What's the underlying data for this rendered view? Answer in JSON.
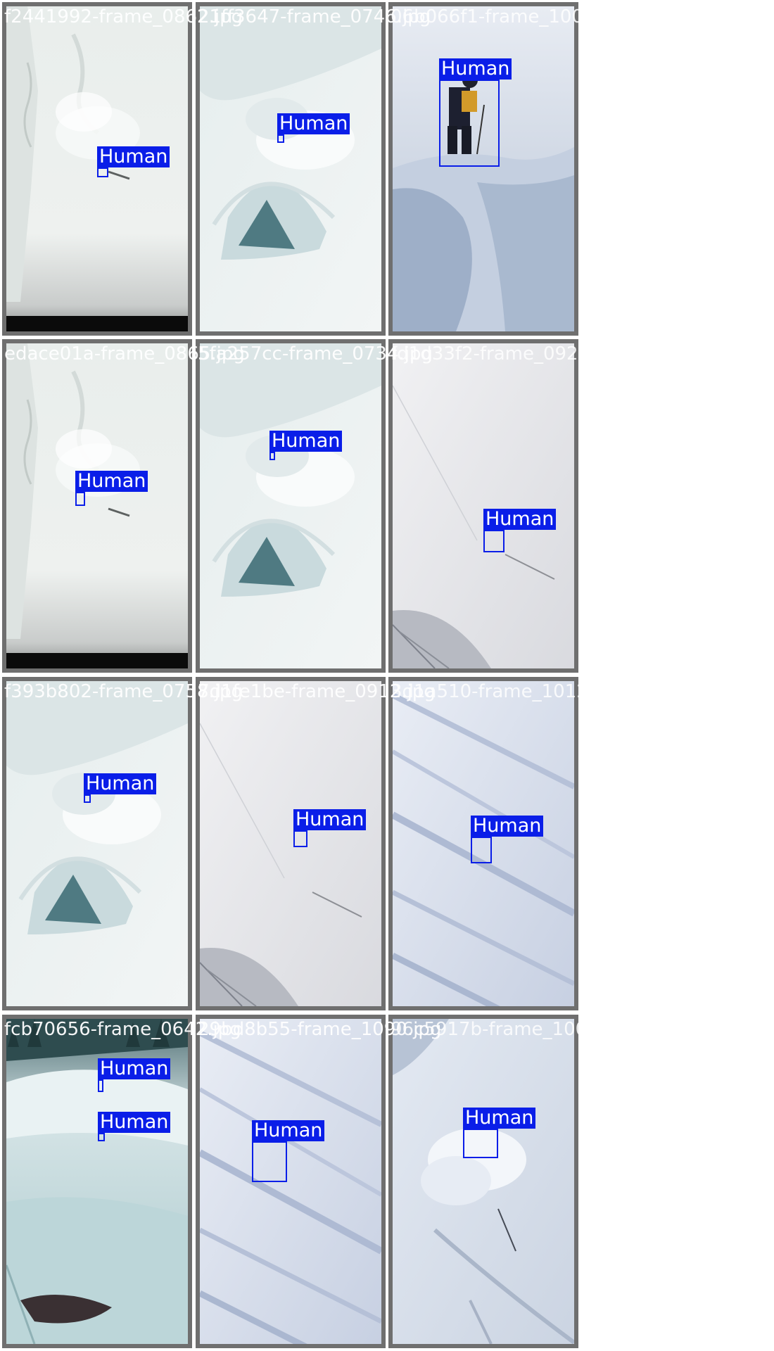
{
  "colors": {
    "box": "#0a1ee8",
    "label_text": "#ffffff",
    "tile_frame": "#6f6f6f"
  },
  "tiles": [
    {
      "filename": "f2441992-frame_0862.jpg",
      "scene": "snow-slope-powder-cloud-dark-bottom",
      "detections": [
        {
          "label": "Human"
        }
      ]
    },
    {
      "filename": "21ff3647-frame_0746.jpg",
      "scene": "snow-slope-powder-cloud-rock",
      "detections": [
        {
          "label": "Human"
        }
      ]
    },
    {
      "filename": "06b066f1-frame_1000.jpg",
      "scene": "skier-standing-on-cornice",
      "detections": [
        {
          "label": "Human"
        }
      ]
    },
    {
      "filename": "edace01a-frame_0865.jpg",
      "scene": "snow-slope-powder-cloud-dark-bottom",
      "detections": [
        {
          "label": "Human"
        }
      ]
    },
    {
      "filename": "5fa257cc-frame_0734.jpg",
      "scene": "snow-slope-powder-cloud-rock",
      "detections": [
        {
          "label": "Human"
        }
      ]
    },
    {
      "filename": "fd1d33f2-frame_0923.jpg",
      "scene": "skier-on-open-snow-face",
      "detections": [
        {
          "label": "Human"
        }
      ]
    },
    {
      "filename": "f393b802-frame_0758.jpg",
      "scene": "snow-slope-powder-cloud-rock",
      "detections": [
        {
          "label": "Human"
        }
      ]
    },
    {
      "filename": "7d1fe1be-frame_0912.jpg",
      "scene": "skier-on-open-snow-face",
      "detections": [
        {
          "label": "Human"
        }
      ]
    },
    {
      "filename": "3d1a510-frame_1012.jpg",
      "scene": "skier-on-steep-blue-snow",
      "detections": [
        {
          "label": "Human"
        }
      ]
    },
    {
      "filename": "fcb70656-frame_0642.jpg",
      "scene": "snowy-cliff-with-trees",
      "detections": [
        {
          "label": "Human"
        },
        {
          "label": "Human"
        }
      ]
    },
    {
      "filename": "29bd8b55-frame_1090.jpg",
      "scene": "skier-on-steep-blue-snow",
      "detections": [
        {
          "label": "Human"
        }
      ]
    },
    {
      "filename": "96c5917b-frame_1002.jpg",
      "scene": "skier-in-snow-spray",
      "detections": [
        {
          "label": "Human"
        }
      ]
    }
  ]
}
